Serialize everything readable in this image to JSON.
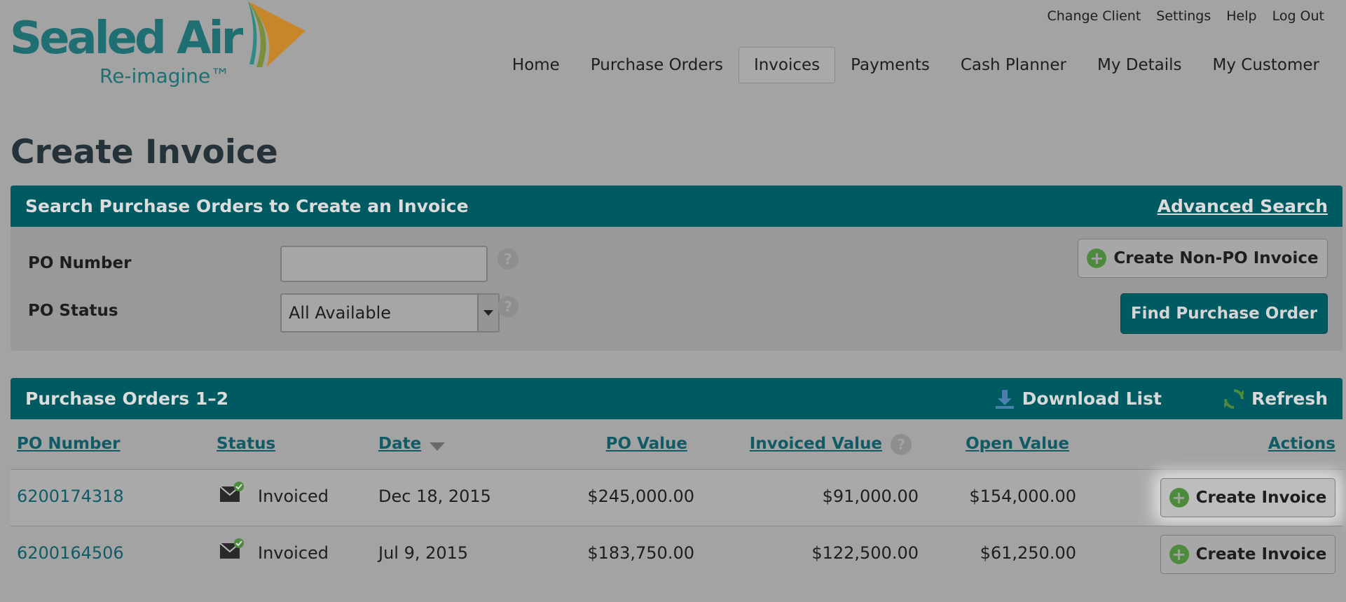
{
  "brand": {
    "name": "Sealed Air",
    "tagline": "Re-imagine™"
  },
  "util_nav": [
    "Change Client",
    "Settings",
    "Help",
    "Log Out"
  ],
  "main_nav": {
    "tabs": [
      "Home",
      "Purchase Orders",
      "Invoices",
      "Payments",
      "Cash Planner",
      "My Details",
      "My Customer"
    ],
    "active": "Invoices"
  },
  "page": {
    "title": "Create Invoice"
  },
  "search": {
    "heading": "Search Purchase Orders to Create an Invoice",
    "advanced_link": "Advanced Search",
    "po_number_label": "PO Number",
    "po_number_value": "",
    "po_status_label": "PO Status",
    "po_status_selected": "All Available",
    "create_non_po_label": "Create Non-PO Invoice",
    "find_label": "Find Purchase Order"
  },
  "purchase_orders": {
    "heading": "Purchase Orders 1–2",
    "download_label": "Download List",
    "refresh_label": "Refresh",
    "columns": {
      "po_number": "PO Number",
      "status": "Status",
      "date": "Date",
      "po_value": "PO Value",
      "invoiced_value": "Invoiced Value",
      "open_value": "Open Value",
      "actions": "Actions"
    },
    "rows": [
      {
        "po_number": "6200174318",
        "status": "Invoiced",
        "date": "Dec 18, 2015",
        "po_value": "$245,000.00",
        "invoiced_value": "$91,000.00",
        "open_value": "$154,000.00",
        "action": "Create Invoice"
      },
      {
        "po_number": "6200164506",
        "status": "Invoiced",
        "date": "Jul 9, 2015",
        "po_value": "$183,750.00",
        "invoiced_value": "$122,500.00",
        "open_value": "$61,250.00",
        "action": "Create Invoice"
      }
    ]
  },
  "colors": {
    "header_teal": "#005a61",
    "link_teal": "#105b66",
    "plus_green": "#4e8a3e",
    "overlay_gray": "#a3a3a3"
  }
}
